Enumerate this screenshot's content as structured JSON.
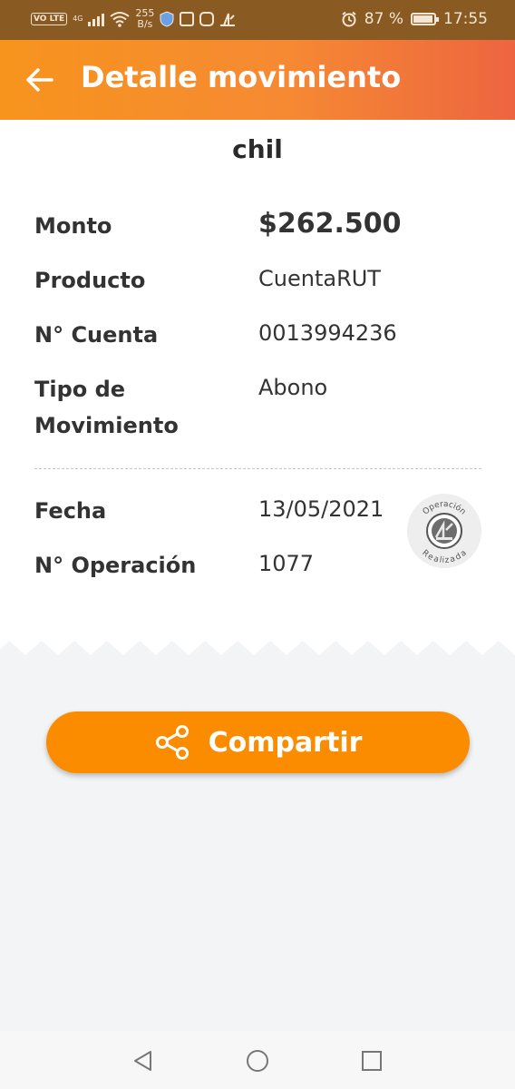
{
  "status_bar": {
    "volte_badge": "VO LTE",
    "network_type": "4G",
    "speed_value": "255",
    "speed_unit": "B/s",
    "battery": "87 %",
    "time": "17:55"
  },
  "header": {
    "title": "Detalle movimiento"
  },
  "card": {
    "cut_title": "chil",
    "rows": [
      {
        "label": "Monto",
        "value": "$262.500"
      },
      {
        "label": "Producto",
        "value": "CuentaRUT"
      },
      {
        "label": "N° Cuenta",
        "value": "0013994236"
      },
      {
        "label_line1": "Tipo de",
        "label_line2": "Movimiento",
        "value": "Abono"
      }
    ],
    "rows2": [
      {
        "label": "Fecha",
        "value": "13/05/2021"
      },
      {
        "label": "N° Operación",
        "value": "1077"
      }
    ],
    "stamp": {
      "top": "Operación",
      "bottom": "Realizada"
    }
  },
  "actions": {
    "share_label": "Compartir"
  },
  "colors": {
    "accent": "#fb8c00",
    "header_start": "#f7941d",
    "header_end": "#ed6540"
  }
}
